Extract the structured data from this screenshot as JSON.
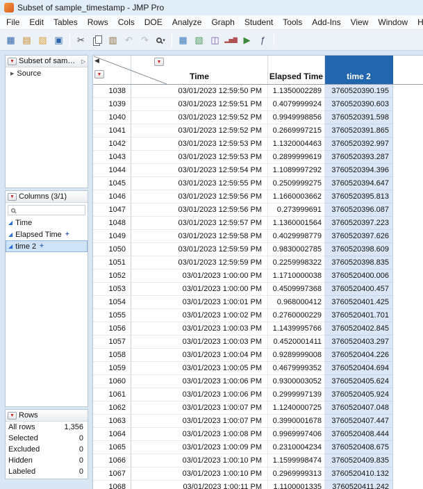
{
  "window": {
    "title": "Subset of sample_timestamp - JMP Pro"
  },
  "menu": {
    "items": [
      "File",
      "Edit",
      "Tables",
      "Rows",
      "Cols",
      "DOE",
      "Analyze",
      "Graph",
      "Student",
      "Tools",
      "Add-Ins",
      "View",
      "Window",
      "Help"
    ]
  },
  "toolbar": {
    "items": [
      {
        "type": "icon",
        "name": "new-data-table-icon",
        "glyph": "▦",
        "color": "#2e66ae"
      },
      {
        "type": "icon",
        "name": "new-journal-icon",
        "glyph": "▤",
        "color": "#c5862a"
      },
      {
        "type": "icon",
        "name": "open-icon",
        "glyph": "▨",
        "color": "#d9a33c"
      },
      {
        "type": "icon",
        "name": "save-icon",
        "glyph": "▣",
        "color": "#2e66ae"
      },
      {
        "type": "sep"
      },
      {
        "type": "icon",
        "name": "cut-icon",
        "glyph": "✂",
        "color": "#4a4a4a"
      },
      {
        "type": "icon",
        "name": "copy-icon",
        "css": "copy"
      },
      {
        "type": "icon",
        "name": "paste-icon",
        "glyph": "▥",
        "color": "#8a7040"
      },
      {
        "type": "icon",
        "name": "undo-icon",
        "glyph": "↶",
        "color": "#b4b9bf"
      },
      {
        "type": "icon",
        "name": "redo-icon",
        "glyph": "↷",
        "color": "#b4b9bf"
      },
      {
        "type": "icon",
        "name": "zoom-icon",
        "css": "mag",
        "dropdown": true
      },
      {
        "type": "sep"
      },
      {
        "type": "icon",
        "name": "data-table-icon",
        "glyph": "▦",
        "color": "#3a7ac2"
      },
      {
        "type": "icon",
        "name": "summary-icon",
        "glyph": "▧",
        "color": "#4f9f63"
      },
      {
        "type": "icon",
        "name": "column-switcher-icon",
        "glyph": "◫",
        "color": "#7a5ab0"
      },
      {
        "type": "icon",
        "name": "graph-builder-icon",
        "glyph": "▂▅▇",
        "color": "#b05050",
        "small": true
      },
      {
        "type": "icon",
        "name": "run-script-icon",
        "glyph": "▶",
        "color": "#3a8a3a"
      },
      {
        "type": "icon",
        "name": "formula-icon",
        "glyph": "ƒ",
        "color": "#44506a"
      },
      {
        "type": "sep"
      }
    ]
  },
  "icons": {
    "red_triangle": "▼",
    "collapse_left": "◀",
    "collapse_right": "▷",
    "disclosure": "▶",
    "continuous": "◢",
    "formula_plus": "+",
    "dropdown_caret": "▾"
  },
  "colors": {
    "titlebar_bg": "#e2edfa",
    "toolbar_bg": "#edf2f9",
    "frame_bg": "#d9e6f4",
    "selected_header_bg": "#2266ae",
    "selected_cell_bg": "#dbe7f6",
    "selected_item_bg": "#cfe3f8",
    "red_triangle": "#cf2222",
    "continuous_blue": "#2a6ed6",
    "grid_line": "#d7dce2"
  },
  "sidebar": {
    "table_panel": {
      "title": "Subset of sampl...",
      "items": [
        {
          "label": "Source"
        }
      ]
    },
    "columns_panel": {
      "title": "Columns (3/1)",
      "search_value": "",
      "items": [
        {
          "label": "Time",
          "formula": false,
          "selected": false
        },
        {
          "label": "Elapsed Time",
          "formula": true,
          "selected": false
        },
        {
          "label": "time 2",
          "formula": true,
          "selected": true
        }
      ]
    },
    "rows_panel": {
      "title": "Rows",
      "stats": [
        {
          "label": "All rows",
          "value": "1,356"
        },
        {
          "label": "Selected",
          "value": "0"
        },
        {
          "label": "Excluded",
          "value": "0"
        },
        {
          "label": "Hidden",
          "value": "0"
        },
        {
          "label": "Labeled",
          "value": "0"
        }
      ]
    }
  },
  "grid": {
    "columns": [
      {
        "key": "time",
        "label": "Time",
        "selected": false
      },
      {
        "key": "elapsed",
        "label": "Elapsed Time",
        "selected": false
      },
      {
        "key": "time2",
        "label": "time 2",
        "selected": true
      }
    ],
    "rows": [
      [
        "1038",
        "03/01/2023 12:59:50 PM",
        "1.1350002289",
        "3760520390.195"
      ],
      [
        "1039",
        "03/01/2023 12:59:51 PM",
        "0.4079999924",
        "3760520390.603"
      ],
      [
        "1040",
        "03/01/2023 12:59:52 PM",
        "0.9949998856",
        "3760520391.598"
      ],
      [
        "1041",
        "03/01/2023 12:59:52 PM",
        "0.2669997215",
        "3760520391.865"
      ],
      [
        "1042",
        "03/01/2023 12:59:53 PM",
        "1.1320004463",
        "3760520392.997"
      ],
      [
        "1043",
        "03/01/2023 12:59:53 PM",
        "0.2899999619",
        "3760520393.287"
      ],
      [
        "1044",
        "03/01/2023 12:59:54 PM",
        "1.1089997292",
        "3760520394.396"
      ],
      [
        "1045",
        "03/01/2023 12:59:55 PM",
        "0.2509999275",
        "3760520394.647"
      ],
      [
        "1046",
        "03/01/2023 12:59:56 PM",
        "1.1660003662",
        "3760520395.813"
      ],
      [
        "1047",
        "03/01/2023 12:59:56 PM",
        "0.273999691",
        "3760520396.087"
      ],
      [
        "1048",
        "03/01/2023 12:59:57 PM",
        "1.1360001564",
        "3760520397.223"
      ],
      [
        "1049",
        "03/01/2023 12:59:58 PM",
        "0.4029998779",
        "3760520397.626"
      ],
      [
        "1050",
        "03/01/2023 12:59:59 PM",
        "0.9830002785",
        "3760520398.609"
      ],
      [
        "1051",
        "03/01/2023 12:59:59 PM",
        "0.2259998322",
        "3760520398.835"
      ],
      [
        "1052",
        "03/01/2023 1:00:00 PM",
        "1.1710000038",
        "3760520400.006"
      ],
      [
        "1053",
        "03/01/2023 1:00:00 PM",
        "0.4509997368",
        "3760520400.457"
      ],
      [
        "1054",
        "03/01/2023 1:00:01 PM",
        "0.968000412",
        "3760520401.425"
      ],
      [
        "1055",
        "03/01/2023 1:00:02 PM",
        "0.2760000229",
        "3760520401.701"
      ],
      [
        "1056",
        "03/01/2023 1:00:03 PM",
        "1.1439995766",
        "3760520402.845"
      ],
      [
        "1057",
        "03/01/2023 1:00:03 PM",
        "0.4520001411",
        "3760520403.297"
      ],
      [
        "1058",
        "03/01/2023 1:00:04 PM",
        "0.9289999008",
        "3760520404.226"
      ],
      [
        "1059",
        "03/01/2023 1:00:05 PM",
        "0.4679999352",
        "3760520404.694"
      ],
      [
        "1060",
        "03/01/2023 1:00:06 PM",
        "0.9300003052",
        "3760520405.624"
      ],
      [
        "1061",
        "03/01/2023 1:00:06 PM",
        "0.2999997139",
        "3760520405.924"
      ],
      [
        "1062",
        "03/01/2023 1:00:07 PM",
        "1.1240000725",
        "3760520407.048"
      ],
      [
        "1063",
        "03/01/2023 1:00:07 PM",
        "0.3990001678",
        "3760520407.447"
      ],
      [
        "1064",
        "03/01/2023 1:00:08 PM",
        "0.9969997406",
        "3760520408.444"
      ],
      [
        "1065",
        "03/01/2023 1:00:09 PM",
        "0.2310004234",
        "3760520408.675"
      ],
      [
        "1066",
        "03/01/2023 1:00:10 PM",
        "1.1599998474",
        "3760520409.835"
      ],
      [
        "1067",
        "03/01/2023 1:00:10 PM",
        "0.2969999313",
        "3760520410.132"
      ],
      [
        "1068",
        "03/01/2023 1:00:11 PM",
        "1.1100001335",
        "3760520411.242"
      ]
    ]
  }
}
